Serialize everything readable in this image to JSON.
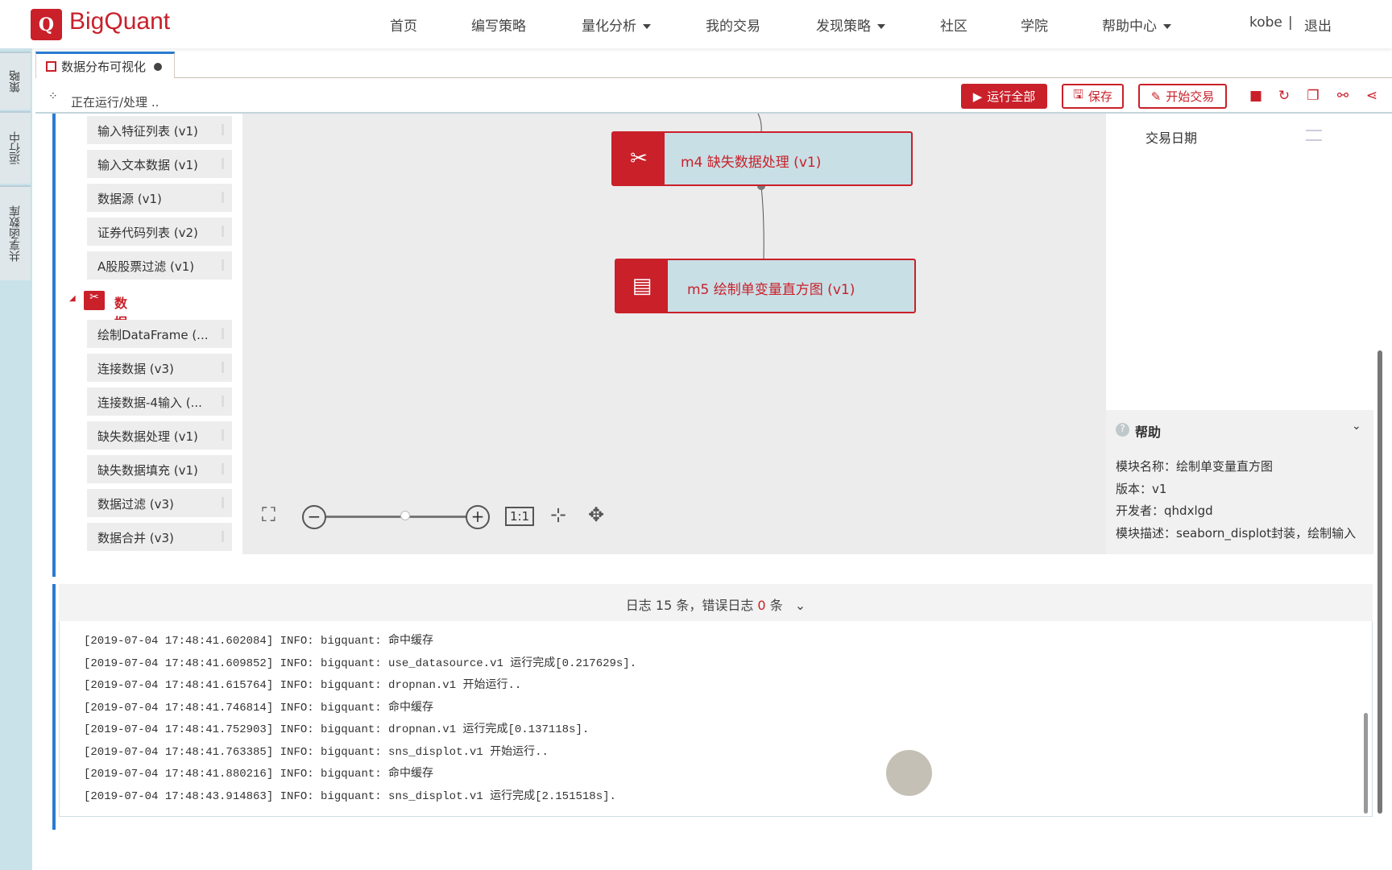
{
  "header": {
    "logo_letter": "Q",
    "brand": "BigQuant",
    "nav": [
      {
        "label": "首页",
        "dropdown": false
      },
      {
        "label": "编写策略",
        "dropdown": false
      },
      {
        "label": "量化分析",
        "dropdown": true
      },
      {
        "label": "我的交易",
        "dropdown": false
      },
      {
        "label": "发现策略",
        "dropdown": true
      },
      {
        "label": "社区",
        "dropdown": false
      },
      {
        "label": "学院",
        "dropdown": false
      },
      {
        "label": "帮助中心",
        "dropdown": true
      }
    ],
    "user": "kobe",
    "separator": "|",
    "logout": "退出"
  },
  "sidebar": {
    "tabs": [
      "策略",
      "运行中",
      "共享函数库"
    ]
  },
  "tab": {
    "title": "数据分布可视化"
  },
  "toolbar": {
    "status": "正在运行/处理 ..",
    "run_all": "运行全部",
    "save": "保存",
    "start_trade": "开始交易"
  },
  "modules": {
    "items_top": [
      "输入特征列表 (v1)",
      "输入文本数据 (v1)",
      "数据源 (v1)",
      "证券代码列表 (v2)",
      "A股股票过滤 (v1)"
    ],
    "category": "数据处理",
    "items": [
      "绘制DataFrame (...",
      "连接数据 (v3)",
      "连接数据-4输入 (...",
      "缺失数据处理 (v1)",
      "缺失数据填充 (v1)",
      "数据过滤 (v3)",
      "数据合并 (v3)"
    ]
  },
  "canvas": {
    "nodes": [
      {
        "label": "m4 缺失数据处理 (v1)"
      },
      {
        "label": "m5 绘制单变量直方图 (v1)"
      }
    ],
    "zoom_reset": "1:1",
    "zoom_level": 0.5
  },
  "right": {
    "field": "交易日期",
    "help_title": "帮助",
    "help": [
      {
        "k": "模块名称：",
        "v": "绘制单变量直方图"
      },
      {
        "k": "版本：",
        "v": "v1"
      },
      {
        "k": "开发者：",
        "v": "qhdxlgd"
      },
      {
        "k": "模块描述：",
        "v": "seaborn_displot封装，绘制输入"
      }
    ]
  },
  "log": {
    "summary_a": "日志 15 条，错误日志 ",
    "error_count": "0",
    "summary_b": " 条",
    "lines": [
      "[2019-07-04 17:48:41.602084] INFO: bigquant: 命中缓存",
      "[2019-07-04 17:48:41.609852] INFO: bigquant: use_datasource.v1 运行完成[0.217629s].",
      "[2019-07-04 17:48:41.615764] INFO: bigquant: dropnan.v1 开始运行..",
      "[2019-07-04 17:48:41.746814] INFO: bigquant: 命中缓存",
      "[2019-07-04 17:48:41.752903] INFO: bigquant: dropnan.v1 运行完成[0.137118s].",
      "[2019-07-04 17:48:41.763385] INFO: bigquant: sns_displot.v1 开始运行..",
      "[2019-07-04 17:48:41.880216] INFO: bigquant: 命中缓存",
      "[2019-07-04 17:48:43.914863] INFO: bigquant: sns_displot.v1 运行完成[2.151518s]."
    ]
  },
  "colors": {
    "brand": "#c9202a",
    "accent": "#2a7bd1"
  }
}
